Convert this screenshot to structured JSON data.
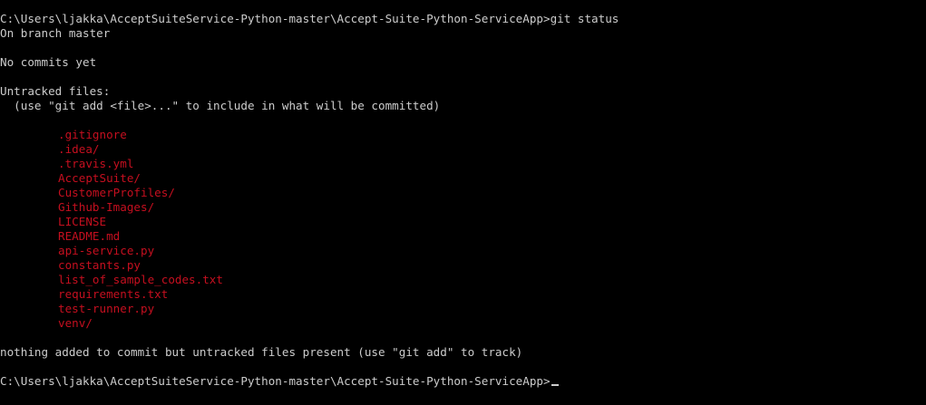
{
  "colors": {
    "background": "#000000",
    "text": "#cccccc",
    "untracked_file": "#c50f1f"
  },
  "terminal": {
    "command_line": "C:\\Users\\ljakka\\AcceptSuiteService-Python-master\\Accept-Suite-Python-ServiceApp>git status",
    "branch_line": "On branch master",
    "no_commits_line": "No commits yet",
    "untracked_header": "Untracked files:",
    "hint_line": "  (use \"git add <file>...\" to include in what will be committed)",
    "untracked_files": [
      ".gitignore",
      ".idea/",
      ".travis.yml",
      "AcceptSuite/",
      "CustomerProfiles/",
      "Github-Images/",
      "LICENSE",
      "README.md",
      "api-service.py",
      "constants.py",
      "list_of_sample_codes.txt",
      "requirements.txt",
      "test-runner.py",
      "venv/"
    ],
    "summary_line": "nothing added to commit but untracked files present (use \"git add\" to track)",
    "prompt_line": "C:\\Users\\ljakka\\AcceptSuiteService-Python-master\\Accept-Suite-Python-ServiceApp>"
  }
}
